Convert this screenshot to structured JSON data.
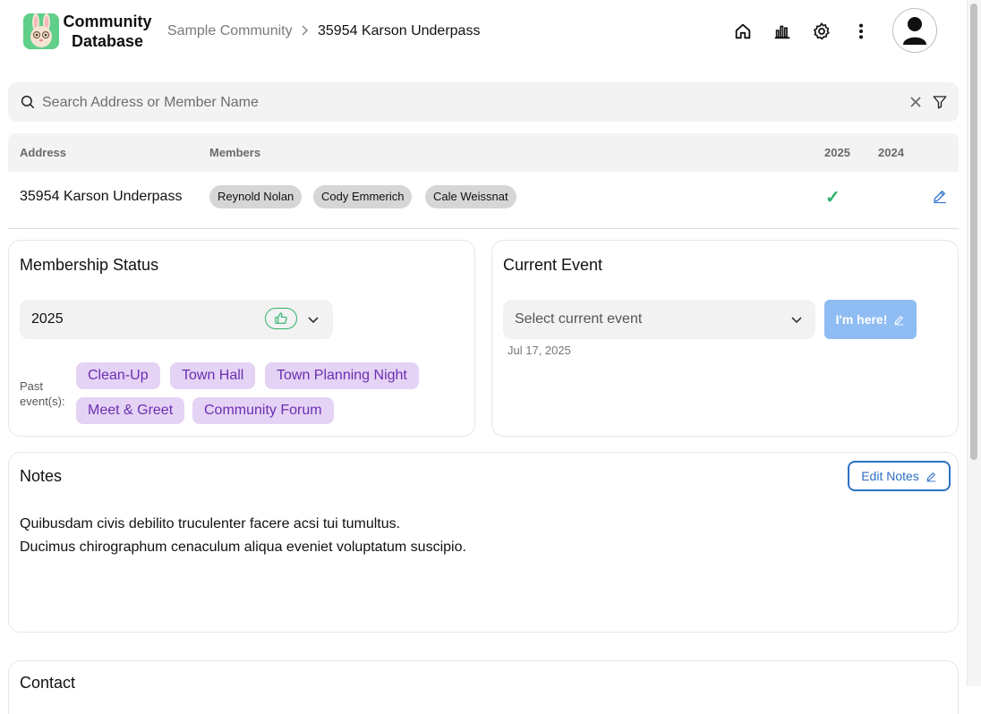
{
  "app": {
    "name_line1": "Community",
    "name_line2": "Database"
  },
  "breadcrumb": {
    "community": "Sample Community",
    "separator": ">",
    "current": "35954 Karson Underpass"
  },
  "header_icons": [
    "home-icon",
    "chart-icon",
    "gear-icon",
    "more-vertical-icon",
    "user-avatar-icon"
  ],
  "search": {
    "placeholder": "Search Address or Member Name",
    "value": ""
  },
  "table": {
    "columns": [
      "Address",
      "Members",
      "2025",
      "2024"
    ],
    "rows": [
      {
        "address": "35954 Karson Underpass",
        "members": [
          "Reynold Nolan",
          "Cody Emmerich",
          "Cale Weissnat"
        ],
        "y2025": "✓",
        "y2024": ""
      }
    ]
  },
  "membership": {
    "title": "Membership Status",
    "selected_year": "2025",
    "past_events_label_line1": "Past",
    "past_events_label_line2": "event(s):",
    "past_events": [
      "Clean-Up",
      "Town Hall",
      "Town Planning Night",
      "Meet & Greet",
      "Community Forum"
    ]
  },
  "current_event": {
    "title": "Current Event",
    "select_placeholder": "Select current event",
    "date": "Jul 17, 2025",
    "button_label": "I'm here!"
  },
  "notes": {
    "title": "Notes",
    "edit_label": "Edit Notes",
    "lines": [
      "Quibusdam civis debilito truculenter facere acsi tui tumultus.",
      "Ducimus chirographum cenaculum aliqua eveniet voluptatum suscipio."
    ]
  },
  "contact": {
    "title": "Contact"
  },
  "colors": {
    "accent": "#2f6fc5",
    "success": "#2fb36b",
    "tag_bg": "#e5d3f5",
    "tag_text": "#6a2fb0"
  }
}
